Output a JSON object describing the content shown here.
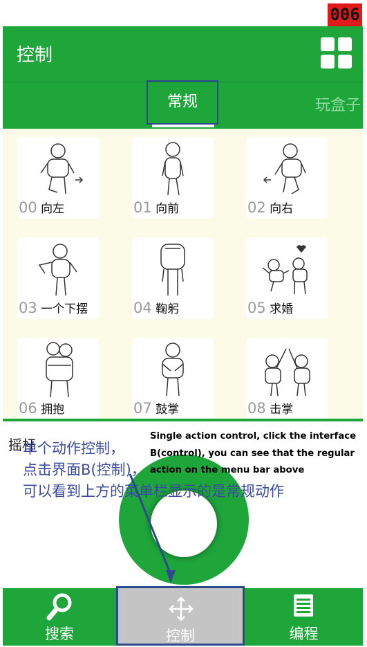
{
  "badge": "006",
  "header": {
    "title": "控制"
  },
  "tabs": [
    {
      "label": "常规"
    },
    {
      "label": "玩盒子"
    }
  ],
  "actions": [
    {
      "num": "00",
      "name": "向左"
    },
    {
      "num": "01",
      "name": "向前"
    },
    {
      "num": "02",
      "name": "向右"
    },
    {
      "num": "03",
      "name": "一个下摆"
    },
    {
      "num": "04",
      "name": "鞠躬"
    },
    {
      "num": "05",
      "name": "求婚"
    },
    {
      "num": "06",
      "name": "拥抱"
    },
    {
      "num": "07",
      "name": "鼓掌"
    },
    {
      "num": "08",
      "name": "击掌"
    }
  ],
  "joystick": {
    "title": "摇杆"
  },
  "annotation": {
    "en": "Single action control, click the interface B(control), you can see that the regular action on the menu bar above",
    "cn_line1": "单个动作控制，",
    "cn_line2": "点击界面B(控制)，",
    "cn_line3": "可以看到上方的菜单栏显示的是常规动作"
  },
  "nav": [
    {
      "label": "搜索",
      "icon": "search-icon"
    },
    {
      "label": "控制",
      "icon": "move-icon"
    },
    {
      "label": "编程",
      "icon": "list-icon"
    }
  ],
  "colors": {
    "primary": "#1ea63b",
    "highlight_box": "#2c4a8d",
    "badge": "#e01b1b",
    "annotation_cn": "#3a4aa0"
  }
}
